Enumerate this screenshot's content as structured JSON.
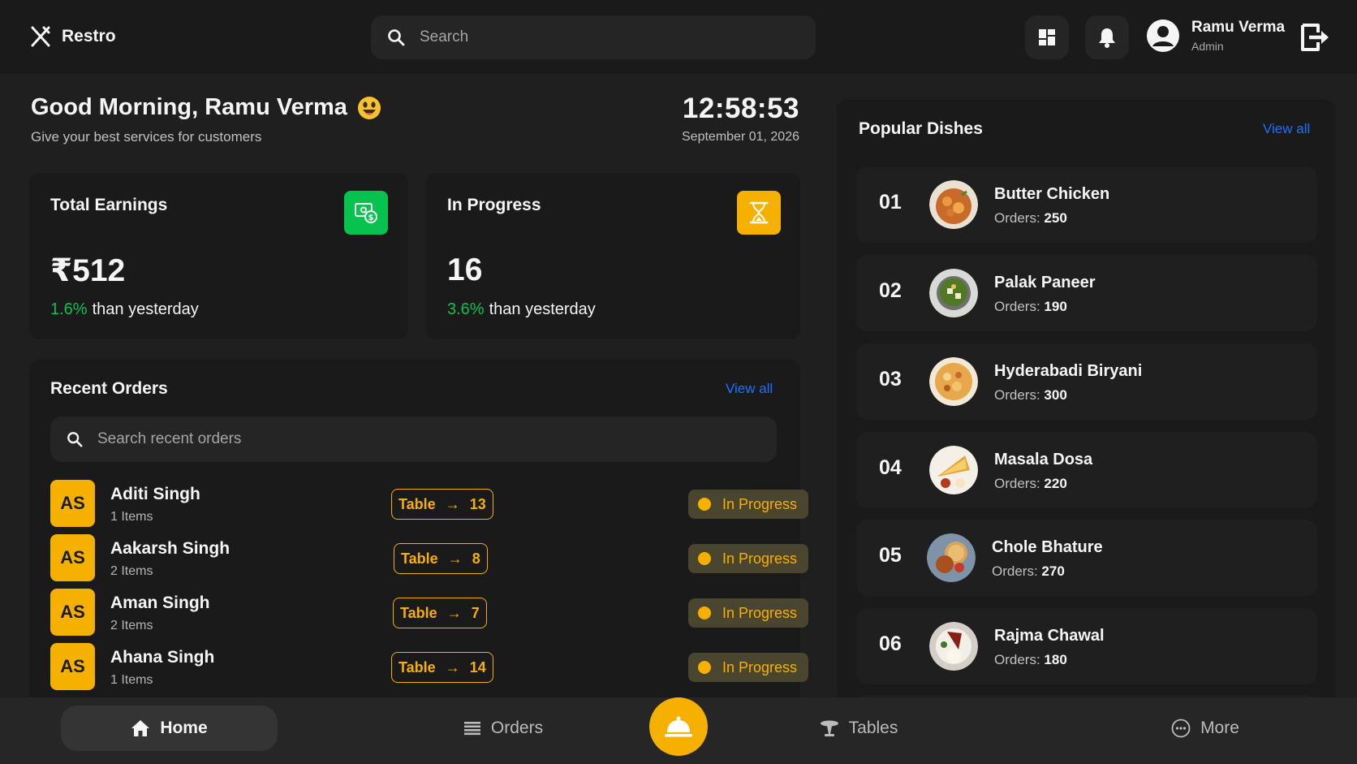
{
  "app": {
    "name": "Restro"
  },
  "header": {
    "search_placeholder": "Search",
    "user": {
      "name": "Ramu Verma",
      "role": "Admin"
    }
  },
  "greeting": {
    "title": "Good Morning, Ramu Verma",
    "subtitle": "Give your best services for customers",
    "time": "12:58:53",
    "date": "September 01, 2026"
  },
  "stats": [
    {
      "title": "Total Earnings",
      "value": "₹512",
      "change": "1.6%",
      "change_text": "than yesterday",
      "icon": "money-icon",
      "color": "#08c24f"
    },
    {
      "title": "In Progress",
      "value": "16",
      "change": "3.6%",
      "change_text": "than yesterday",
      "icon": "hourglass-icon",
      "color": "#f6b100"
    }
  ],
  "recent_orders": {
    "title": "Recent Orders",
    "view_all": "View all",
    "search_placeholder": "Search recent orders",
    "orders": [
      {
        "initials": "AS",
        "name": "Aditi Singh",
        "items": "1 Items",
        "table_label": "Table",
        "table": "13",
        "status": "In Progress"
      },
      {
        "initials": "AS",
        "name": "Aakarsh Singh",
        "items": "2 Items",
        "table_label": "Table",
        "table": "8",
        "status": "In Progress"
      },
      {
        "initials": "AS",
        "name": "Aman Singh",
        "items": "2 Items",
        "table_label": "Table",
        "table": "7",
        "status": "In Progress"
      },
      {
        "initials": "AS",
        "name": "Ahana Singh",
        "items": "1 Items",
        "table_label": "Table",
        "table": "14",
        "status": "In Progress"
      }
    ]
  },
  "popular_dishes": {
    "title": "Popular Dishes",
    "view_all": "View all",
    "orders_label": "Orders:",
    "dishes": [
      {
        "num": "01",
        "name": "Butter Chicken",
        "orders": "250"
      },
      {
        "num": "02",
        "name": "Palak Paneer",
        "orders": "190"
      },
      {
        "num": "03",
        "name": "Hyderabadi Biryani",
        "orders": "300"
      },
      {
        "num": "04",
        "name": "Masala Dosa",
        "orders": "220"
      },
      {
        "num": "05",
        "name": "Chole Bhature",
        "orders": "270"
      },
      {
        "num": "06",
        "name": "Rajma Chawal",
        "orders": "180"
      }
    ]
  },
  "bottom_nav": {
    "home": "Home",
    "orders": "Orders",
    "tables": "Tables",
    "more": "More"
  },
  "colors": {
    "accent": "#f6b100",
    "green": "#08c24f",
    "link": "#1a72ff",
    "background": "#1f1f1f",
    "surface": "#1a1a1a"
  }
}
